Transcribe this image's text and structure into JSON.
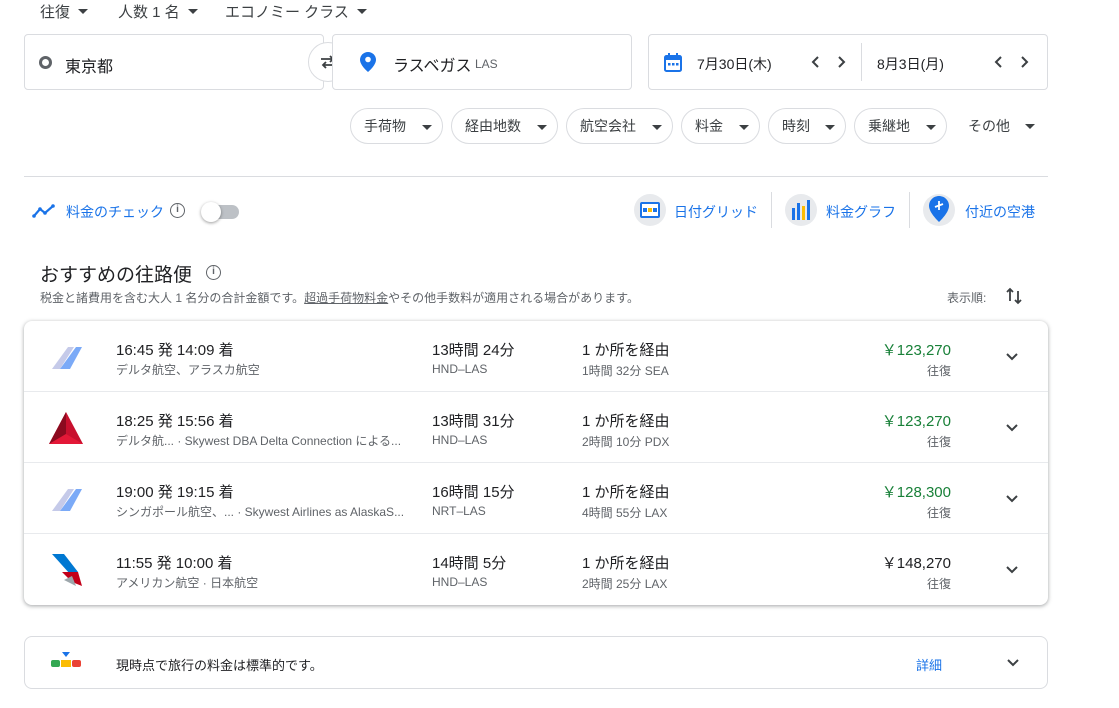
{
  "top_options": {
    "trip_type": "往復",
    "passengers": "人数 1 名",
    "cabin_class": "エコノミー クラス"
  },
  "search": {
    "origin": "東京都",
    "destination": "ラスベガス",
    "destination_code": "LAS",
    "depart_date": "7月30日(木)",
    "return_date": "8月3日(月)"
  },
  "filters": [
    "手荷物",
    "経由地数",
    "航空会社",
    "料金",
    "時刻",
    "乗継地",
    "その他"
  ],
  "tools": {
    "price_tracking": "料金のチェック",
    "date_grid": "日付グリッド",
    "price_graph": "料金グラフ",
    "nearby_airports": "付近の空港"
  },
  "section": {
    "title": "おすすめの往路便",
    "note_before": "税金と諸費用を含む大人 1 名分の合計金額です。",
    "note_link": "超過手荷物料金",
    "note_after": "やその他手数料が適用される場合があります。",
    "sort_label": "表示順:"
  },
  "flights": [
    {
      "times": "16:45 発 14:09 着",
      "airlines": "デルタ航空、アラスカ航空",
      "duration": "13時間 24分",
      "route": "HND–LAS",
      "stops": "1 か所を経由",
      "layover": "1時間 32分 SEA",
      "price": "￥123,270",
      "price_type": "往復",
      "price_color": "#188038",
      "logo": "alaska-logo-icon"
    },
    {
      "times": "18:25 発 15:56 着",
      "airlines": "デルタ航... · Skywest DBA Delta Connection による...",
      "duration": "13時間 31分",
      "route": "HND–LAS",
      "stops": "1 か所を経由",
      "layover": "2時間 10分 PDX",
      "price": "￥123,270",
      "price_type": "往復",
      "price_color": "#188038",
      "logo": "delta-logo-icon"
    },
    {
      "times": "19:00 発 19:15 着",
      "airlines": "シンガポール航空、... · Skywest Airlines as AlaskaS...",
      "duration": "16時間 15分",
      "route": "NRT–LAS",
      "stops": "1 か所を経由",
      "layover": "4時間 55分 LAX",
      "price": "￥128,300",
      "price_type": "往復",
      "price_color": "#188038",
      "logo": "alaska-logo-icon"
    },
    {
      "times": "11:55 発 10:00 着",
      "airlines": "アメリカン航空 · 日本航空",
      "duration": "14時間 5分",
      "route": "HND–LAS",
      "stops": "1 か所を経由",
      "layover": "2時間 25分 LAX",
      "price": "￥148,270",
      "price_type": "往復",
      "price_color": "#202124",
      "logo": "american-logo-icon"
    }
  ],
  "price_insight": {
    "text": "現時点で旅行の料金は標準的です。",
    "details": "詳細"
  },
  "colors": {
    "accent": "#1a73e8",
    "price_green": "#188038"
  }
}
